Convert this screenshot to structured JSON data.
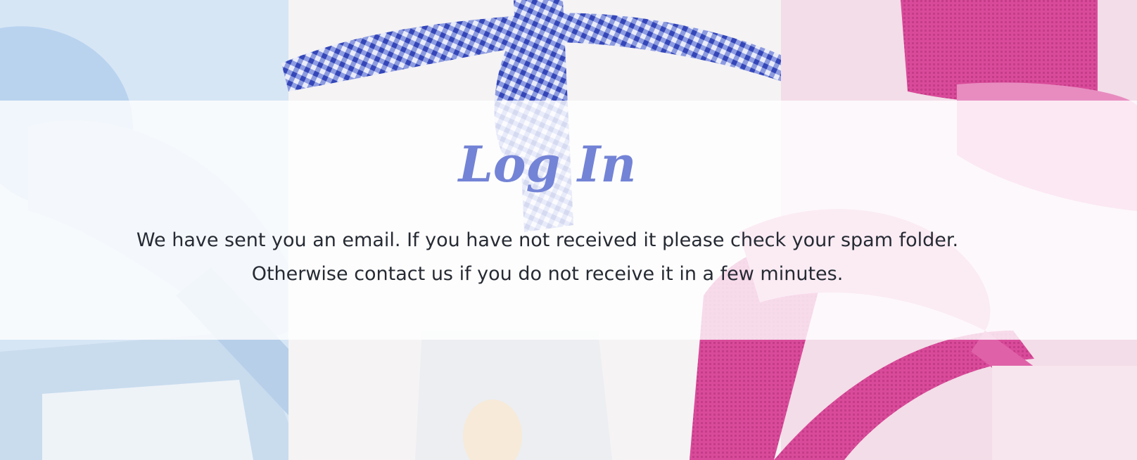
{
  "page": {
    "title": "Log In",
    "message_line_1": "We have sent you an email. If you have not received it please check your spam folder.",
    "message_line_2": "Otherwise contact us if you do not receive it in a few minutes."
  },
  "colors": {
    "title": "#7383d6",
    "text": "#262a33",
    "panel_overlay": "rgba(255,255,255,0.80)",
    "ribbon_blue_gingham": "#4b5ec9",
    "ribbon_pink": "#d84a98",
    "ribbon_light_blue": "#bcd7f0",
    "gift_box_white": "#f4f6f8"
  }
}
